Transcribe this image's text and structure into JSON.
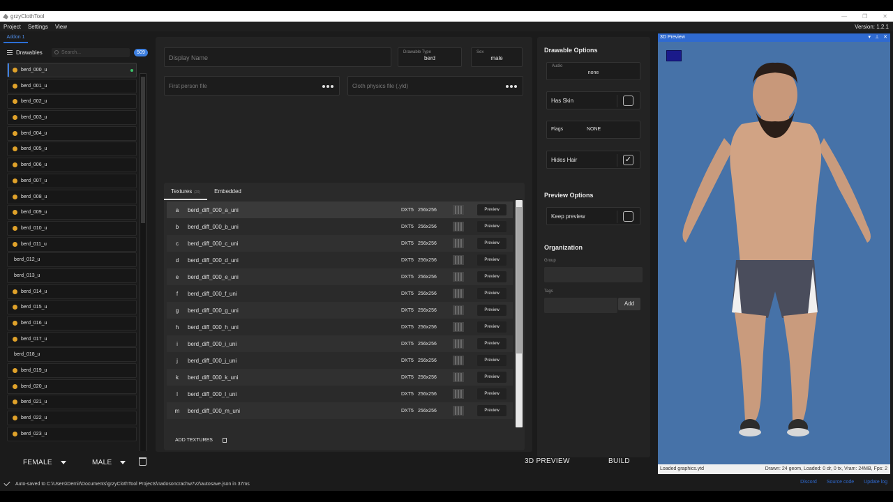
{
  "window": {
    "title": "grzyClothTool"
  },
  "menu": {
    "items": [
      "Project",
      "Settings",
      "View"
    ],
    "version": "Version: 1.2.1"
  },
  "sidebar": {
    "addon_tab": "Addon 1",
    "header": "Drawables",
    "search_placeholder": "Search...",
    "count": "509",
    "items": [
      {
        "label": "berd_000_u",
        "warn": true,
        "selected": true
      },
      {
        "label": "berd_001_u",
        "warn": true
      },
      {
        "label": "berd_002_u",
        "warn": true
      },
      {
        "label": "berd_003_u",
        "warn": true
      },
      {
        "label": "berd_004_u",
        "warn": true
      },
      {
        "label": "berd_005_u",
        "warn": true
      },
      {
        "label": "berd_006_u",
        "warn": true
      },
      {
        "label": "berd_007_u",
        "warn": true
      },
      {
        "label": "berd_008_u",
        "warn": true
      },
      {
        "label": "berd_009_u",
        "warn": true
      },
      {
        "label": "berd_010_u",
        "warn": true
      },
      {
        "label": "berd_011_u",
        "warn": true
      },
      {
        "label": "berd_012_u",
        "warn": false
      },
      {
        "label": "berd_013_u",
        "warn": false
      },
      {
        "label": "berd_014_u",
        "warn": true
      },
      {
        "label": "berd_015_u",
        "warn": true
      },
      {
        "label": "berd_016_u",
        "warn": true
      },
      {
        "label": "berd_017_u",
        "warn": true
      },
      {
        "label": "berd_018_u",
        "warn": false
      },
      {
        "label": "berd_019_u",
        "warn": true
      },
      {
        "label": "berd_020_u",
        "warn": true
      },
      {
        "label": "berd_021_u",
        "warn": true
      },
      {
        "label": "berd_022_u",
        "warn": true
      },
      {
        "label": "berd_023_u",
        "warn": true
      }
    ],
    "female_label": "FEMALE",
    "male_label": "MALE"
  },
  "details": {
    "display_name_placeholder": "Display Name",
    "drawable_type_label": "Drawable Type",
    "drawable_type_value": "berd",
    "sex_label": "Sex",
    "sex_value": "male",
    "first_person_placeholder": "First person file",
    "cloth_physics_placeholder": "Cloth physics file (.yld)"
  },
  "textures": {
    "tab_textures": "Textures",
    "tab_textures_count": "(20)",
    "tab_embedded": "Embedded",
    "add_label": "ADD TEXTURES",
    "preview_label": "Preview",
    "rows": [
      {
        "letter": "a",
        "name": "berd_diff_000_a_uni",
        "format": "DXT5",
        "size": "256x256"
      },
      {
        "letter": "b",
        "name": "berd_diff_000_b_uni",
        "format": "DXT5",
        "size": "256x256"
      },
      {
        "letter": "c",
        "name": "berd_diff_000_c_uni",
        "format": "DXT5",
        "size": "256x256"
      },
      {
        "letter": "d",
        "name": "berd_diff_000_d_uni",
        "format": "DXT5",
        "size": "256x256"
      },
      {
        "letter": "e",
        "name": "berd_diff_000_e_uni",
        "format": "DXT5",
        "size": "256x256"
      },
      {
        "letter": "f",
        "name": "berd_diff_000_f_uni",
        "format": "DXT5",
        "size": "256x256"
      },
      {
        "letter": "g",
        "name": "berd_diff_000_g_uni",
        "format": "DXT5",
        "size": "256x256"
      },
      {
        "letter": "h",
        "name": "berd_diff_000_h_uni",
        "format": "DXT5",
        "size": "256x256"
      },
      {
        "letter": "i",
        "name": "berd_diff_000_i_uni",
        "format": "DXT5",
        "size": "256x256"
      },
      {
        "letter": "j",
        "name": "berd_diff_000_j_uni",
        "format": "DXT5",
        "size": "256x256"
      },
      {
        "letter": "k",
        "name": "berd_diff_000_k_uni",
        "format": "DXT5",
        "size": "256x256"
      },
      {
        "letter": "l",
        "name": "berd_diff_000_l_uni",
        "format": "DXT5",
        "size": "256x256"
      },
      {
        "letter": "m",
        "name": "berd_diff_000_m_uni",
        "format": "DXT5",
        "size": "256x256"
      }
    ]
  },
  "options": {
    "drawable_title": "Drawable Options",
    "audio_label": "Audio",
    "audio_value": "none",
    "has_skin_label": "Has Skin",
    "has_skin": false,
    "flags_label": "Flags",
    "flags_value": "NONE",
    "hides_hair_label": "Hides Hair",
    "hides_hair": true,
    "check_mark": "✓",
    "preview_title": "Preview Options",
    "keep_preview_label": "Keep preview",
    "keep_preview": false,
    "org_title": "Organization",
    "group_label": "Group",
    "tags_label": "Tags",
    "add_label": "Add"
  },
  "actions": {
    "preview_3d": "3D PREVIEW",
    "build": "BUILD"
  },
  "preview": {
    "title": "3D Preview",
    "swatch_color": "#1a1a8a",
    "status_left": "Loaded graphics.ytd",
    "status_right": "Drawn: 24 geom, Loaded: 0 dr, 0 tx, Vram: 24MB, Fps: 2"
  },
  "statusbar": {
    "text": "Auto-saved to C:\\Users\\Demir\\Documents\\grzyClothTool Projects\\nadosoncrachw7v2\\autosave.json in 37ms",
    "links": [
      "Discord",
      "Source code",
      "Update log"
    ]
  }
}
